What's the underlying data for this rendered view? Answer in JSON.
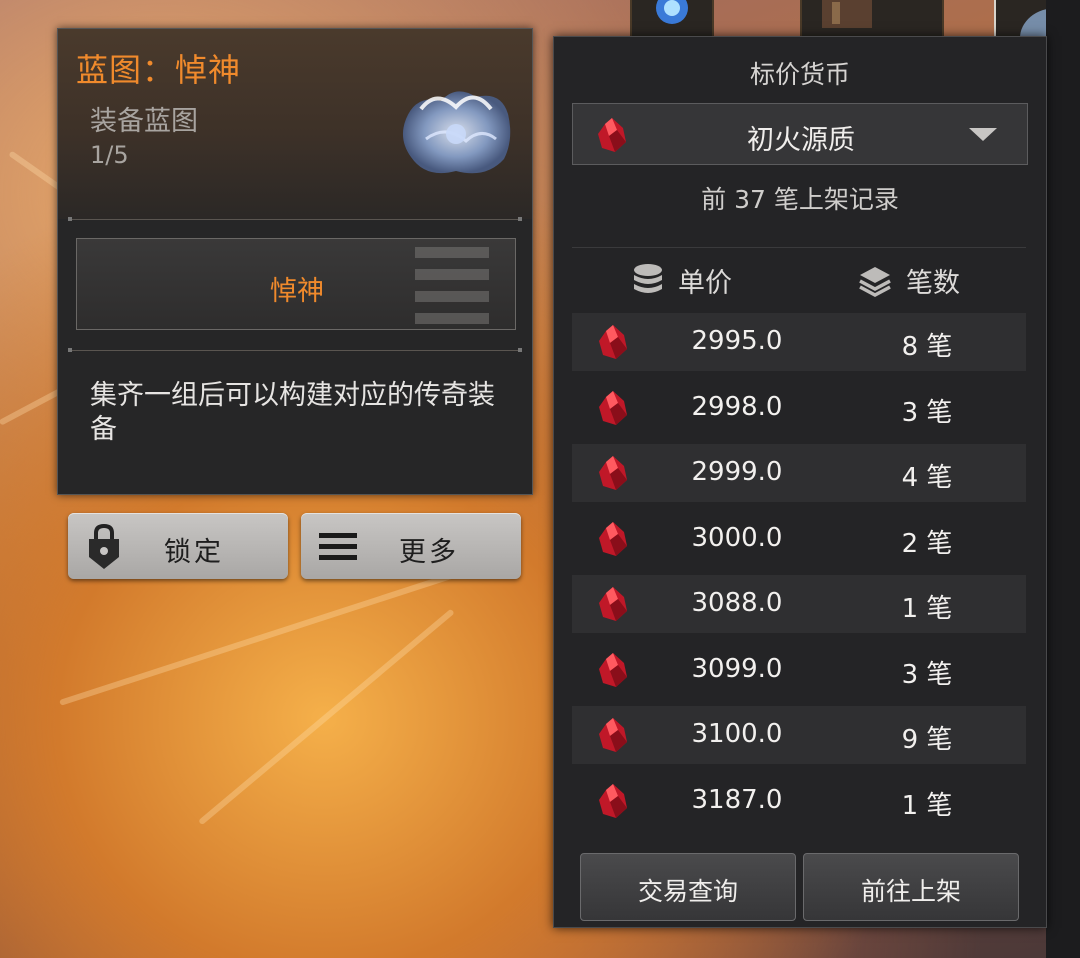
{
  "item": {
    "title": "蓝图：悼神",
    "type": "装备蓝图",
    "count": "1/5",
    "set_name": "悼神",
    "description": "集齐一组后可以构建对应的传奇装备"
  },
  "actions": {
    "lock_label": "锁定",
    "more_label": "更多"
  },
  "price_panel": {
    "title": "标价货币",
    "currency": "初火源质",
    "record_text": "前 37 笔上架记录",
    "col_price": "单价",
    "col_count": "笔数",
    "rows": [
      {
        "price": "2995.0",
        "count": "8 笔"
      },
      {
        "price": "2998.0",
        "count": "3 笔"
      },
      {
        "price": "2999.0",
        "count": "4 笔"
      },
      {
        "price": "3000.0",
        "count": "2 笔"
      },
      {
        "price": "3088.0",
        "count": "1 笔"
      },
      {
        "price": "3099.0",
        "count": "3 笔"
      },
      {
        "price": "3100.0",
        "count": "9 笔"
      },
      {
        "price": "3187.0",
        "count": "1 笔"
      }
    ],
    "query_button": "交易查询",
    "list_button": "前往上架"
  },
  "colors": {
    "accent_orange": "#f08a2c",
    "panel_bg": "#242426",
    "crystal_red": "#d8202c"
  },
  "icons": [
    "lock-icon",
    "menu-icon",
    "coins-icon",
    "stack-icon",
    "crystal-icon",
    "chevron-down-icon"
  ]
}
